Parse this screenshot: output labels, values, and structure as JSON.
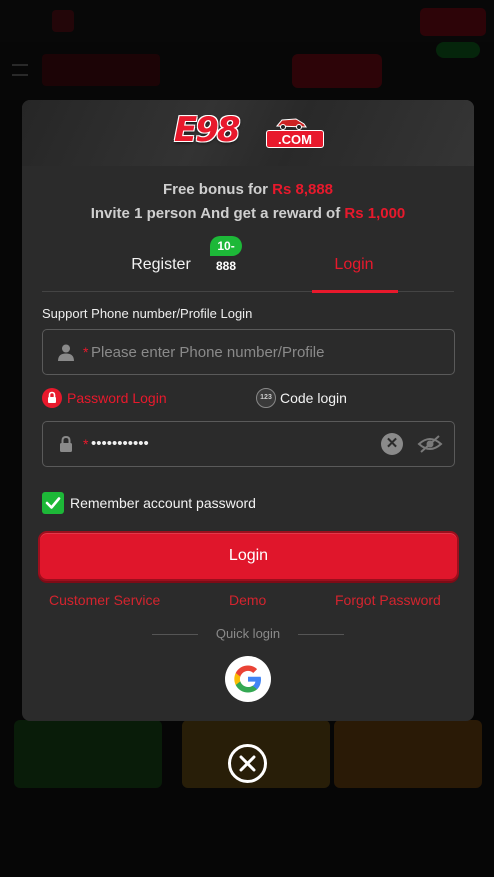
{
  "modal": {
    "logo": {
      "main": "E98",
      "suffix": ".COM"
    },
    "promo": {
      "line1_prefix": "Free bonus for ",
      "line1_amount": "Rs 8,888",
      "line2_prefix": "Invite 1 person And get a reward of ",
      "line2_amount": "Rs 1,000"
    },
    "tabs": {
      "register_label": "Register",
      "register_badge": "10-888",
      "login_label": "Login",
      "active": "Login"
    },
    "form": {
      "support_label": "Support Phone number/Profile Login",
      "phone_required_mark": "*",
      "phone_placeholder": "Please enter Phone number/Profile",
      "phone_value": "",
      "password_mode_label": "Password Login",
      "code_mode_label": "Code login",
      "code_mode_icon_text": "123",
      "password_required_mark": "*",
      "password_value": "•••••••••••",
      "remember_label": "Remember account password",
      "remember_checked": true,
      "submit_label": "Login"
    },
    "links": {
      "customer_service": "Customer Service",
      "demo": "Demo",
      "forgot_password": "Forgot Password"
    },
    "quick_login": {
      "label": "Quick login",
      "providers": [
        "google-icon"
      ]
    }
  },
  "icons": {
    "user": "user-icon",
    "lock": "lock-icon",
    "clear": "clear-icon",
    "eye_off": "eye-off-icon",
    "close": "close-icon",
    "checkmark": "checkmark-icon"
  },
  "colors": {
    "accent": "#e8192c",
    "success": "#1db838",
    "modal_bg": "#2b2b2b",
    "muted_text": "#8a8a8a"
  }
}
